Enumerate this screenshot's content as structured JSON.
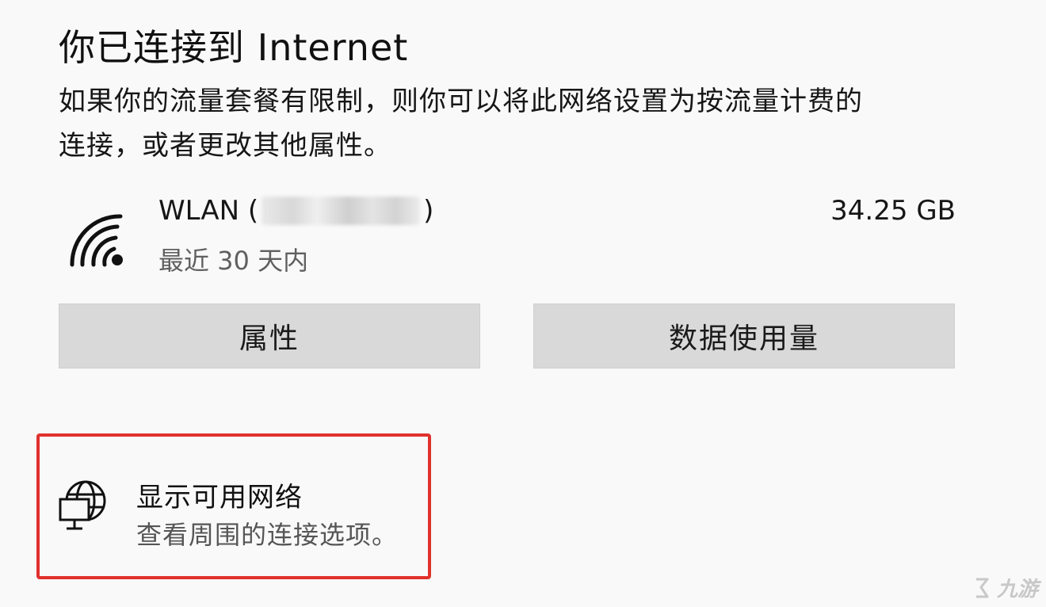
{
  "header": {
    "title": "你已连接到 Internet",
    "description_line1": "如果你的流量套餐有限制，则你可以将此网络设置为按流量计费的",
    "description_line2": "连接，或者更改其他属性。"
  },
  "network": {
    "name_prefix": "WLAN (",
    "name_suffix": ")",
    "period": "最近 30 天内",
    "usage": "34.25 GB",
    "icon": "wifi-icon"
  },
  "buttons": {
    "properties": "属性",
    "data_usage": "数据使用量"
  },
  "show_networks": {
    "title": "显示可用网络",
    "subtitle": "查看周围的连接选项。",
    "icon": "globe-network-icon",
    "highlight_color": "#e0312d"
  },
  "watermark": {
    "text": "九游"
  }
}
